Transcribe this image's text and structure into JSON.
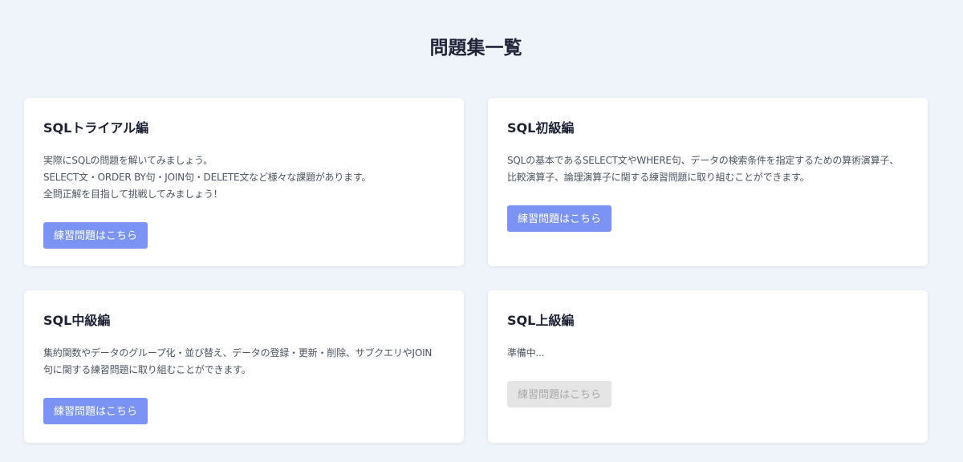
{
  "page": {
    "title": "問題集一覧"
  },
  "cards": [
    {
      "title": "SQLトライアル編",
      "description": "実際にSQLの問題を解いてみましょう。\nSELECT文・ORDER BY句・JOIN句・DELETE文など様々な課題があります。\n全問正解を目指して挑戦してみましょう！",
      "button_label": "練習問題はこちら",
      "button_enabled": true
    },
    {
      "title": "SQL初級編",
      "description": "SQLの基本であるSELECT文やWHERE句、データの検索条件を指定するための算術演算子、\n比較演算子、論理演算子に関する練習問題に取り組むことができます。",
      "button_label": "練習問題はこちら",
      "button_enabled": true
    },
    {
      "title": "SQL中級編",
      "description": "集約関数やデータのグループ化・並び替え、データの登録・更新・削除、サブクエリやJOIN\n句に関する練習問題に取り組むことができます。",
      "button_label": "練習問題はこちら",
      "button_enabled": true
    },
    {
      "title": "SQL上級編",
      "description": "準備中...",
      "button_label": "練習問題はこちら",
      "button_enabled": false
    }
  ],
  "colors": {
    "background": "#eff3fa",
    "accent": "#7b93f4",
    "disabled": "#e5e5e5"
  }
}
